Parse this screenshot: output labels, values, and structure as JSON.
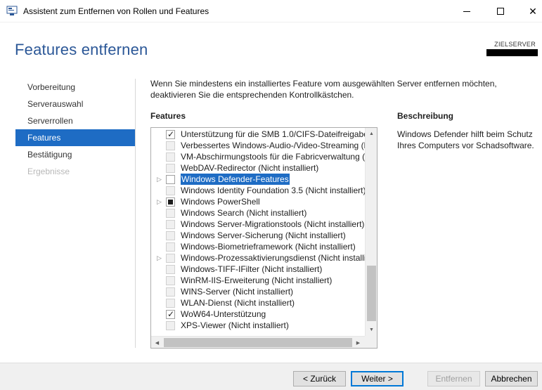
{
  "window": {
    "title": "Assistent zum Entfernen von Rollen und Features",
    "minimize_glyph": "",
    "close_glyph": "✕"
  },
  "header": {
    "page_title": "Features entfernen",
    "target_label": "ZIELSERVER"
  },
  "nav": {
    "items": [
      {
        "label": "Vorbereitung",
        "state": "normal"
      },
      {
        "label": "Serverauswahl",
        "state": "normal"
      },
      {
        "label": "Serverrollen",
        "state": "normal"
      },
      {
        "label": "Features",
        "state": "active"
      },
      {
        "label": "Bestätigung",
        "state": "normal"
      },
      {
        "label": "Ergebnisse",
        "state": "disabled"
      }
    ]
  },
  "main": {
    "intro": "Wenn Sie mindestens ein installiertes Feature vom ausgewählten Server entfernen möchten, deaktivieren Sie die entsprechenden Kontrollkästchen.",
    "features_heading": "Features",
    "description_heading": "Beschreibung",
    "description_text": "Windows Defender hilft beim Schutz Ihres Computers vor Schadsoftware.",
    "features": [
      {
        "label": "Unterstützung für die SMB 1.0/CIFS-Dateifreigabe",
        "state": "checked",
        "expandable": false,
        "selected": false
      },
      {
        "label": "Verbessertes Windows-Audio-/Video-Streaming (N",
        "state": "disabled",
        "expandable": false,
        "selected": false
      },
      {
        "label": "VM-Abschirmungstools für die Fabricverwaltung (N",
        "state": "disabled",
        "expandable": false,
        "selected": false
      },
      {
        "label": "WebDAV-Redirector (Nicht installiert)",
        "state": "disabled",
        "expandable": false,
        "selected": false
      },
      {
        "label": "Windows Defender-Features",
        "state": "unchecked",
        "expandable": true,
        "selected": true
      },
      {
        "label": "Windows Identity Foundation 3.5 (Nicht installiert)",
        "state": "disabled",
        "expandable": false,
        "selected": false
      },
      {
        "label": "Windows PowerShell",
        "state": "partial",
        "expandable": true,
        "selected": false
      },
      {
        "label": "Windows Search (Nicht installiert)",
        "state": "disabled",
        "expandable": false,
        "selected": false
      },
      {
        "label": "Windows Server-Migrationstools (Nicht installiert)",
        "state": "disabled",
        "expandable": false,
        "selected": false
      },
      {
        "label": "Windows Server-Sicherung (Nicht installiert)",
        "state": "disabled",
        "expandable": false,
        "selected": false
      },
      {
        "label": "Windows-Biometrieframework (Nicht installiert)",
        "state": "disabled",
        "expandable": false,
        "selected": false
      },
      {
        "label": "Windows-Prozessaktivierungsdienst (Nicht installie",
        "state": "disabled",
        "expandable": true,
        "selected": false
      },
      {
        "label": "Windows-TIFF-IFilter (Nicht installiert)",
        "state": "disabled",
        "expandable": false,
        "selected": false
      },
      {
        "label": "WinRM-IIS-Erweiterung (Nicht installiert)",
        "state": "disabled",
        "expandable": false,
        "selected": false
      },
      {
        "label": "WINS-Server (Nicht installiert)",
        "state": "disabled",
        "expandable": false,
        "selected": false
      },
      {
        "label": "WLAN-Dienst (Nicht installiert)",
        "state": "disabled",
        "expandable": false,
        "selected": false
      },
      {
        "label": "WoW64-Unterstützung",
        "state": "checked",
        "expandable": false,
        "selected": false
      },
      {
        "label": "XPS-Viewer (Nicht installiert)",
        "state": "disabled",
        "expandable": false,
        "selected": false
      }
    ]
  },
  "footer": {
    "back_label": "< Zurück",
    "next_label": "Weiter >",
    "remove_label": "Entfernen",
    "cancel_label": "Abbrechen"
  },
  "icons": {
    "expander": "▷",
    "scroll_up": "▲",
    "scroll_down": "▼",
    "scroll_left": "◀",
    "scroll_right": "▶"
  },
  "colors": {
    "accent": "#1e6cc4",
    "title": "#2b5797"
  }
}
